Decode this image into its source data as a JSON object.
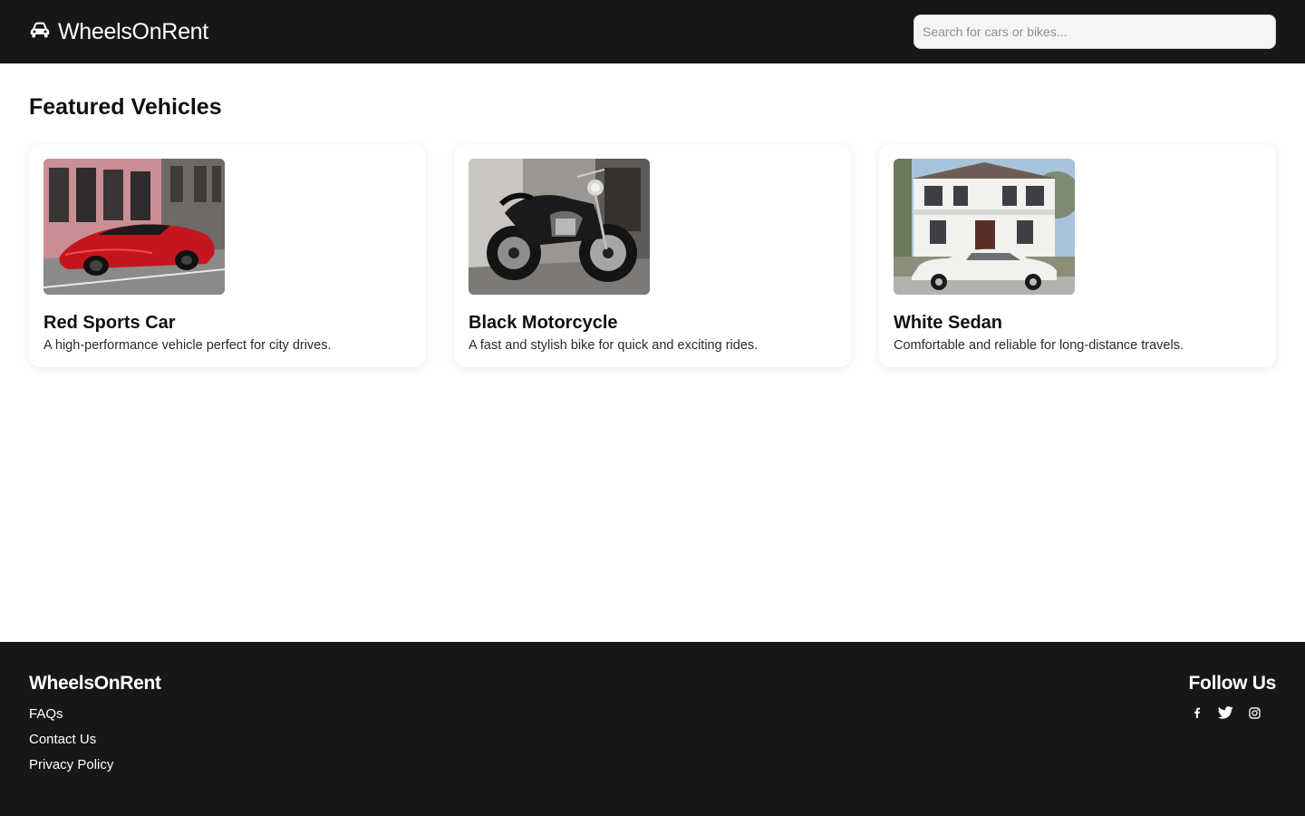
{
  "header": {
    "brand_icon": "car-icon",
    "brand_name": "WheelsOnRent",
    "search_placeholder": "Search for cars or bikes..."
  },
  "main": {
    "section_title": "Featured Vehicles",
    "cards": [
      {
        "image": "red-sports-car-photo",
        "title": "Red Sports Car",
        "description": "A high-performance vehicle perfect for city drives."
      },
      {
        "image": "black-motorcycle-photo",
        "title": "Black Motorcycle",
        "description": "A fast and stylish bike for quick and exciting rides."
      },
      {
        "image": "white-sedan-photo",
        "title": "White Sedan",
        "description": "Comfortable and reliable for long-distance travels."
      }
    ]
  },
  "footer": {
    "brand": "WheelsOnRent",
    "links": [
      "FAQs",
      "Contact Us",
      "Privacy Policy"
    ],
    "follow_title": "Follow Us",
    "socials": [
      "facebook-icon",
      "twitter-icon",
      "instagram-icon"
    ]
  },
  "colors": {
    "header_bg": "#171717",
    "footer_bg": "#171717",
    "page_bg": "#ffffff"
  }
}
